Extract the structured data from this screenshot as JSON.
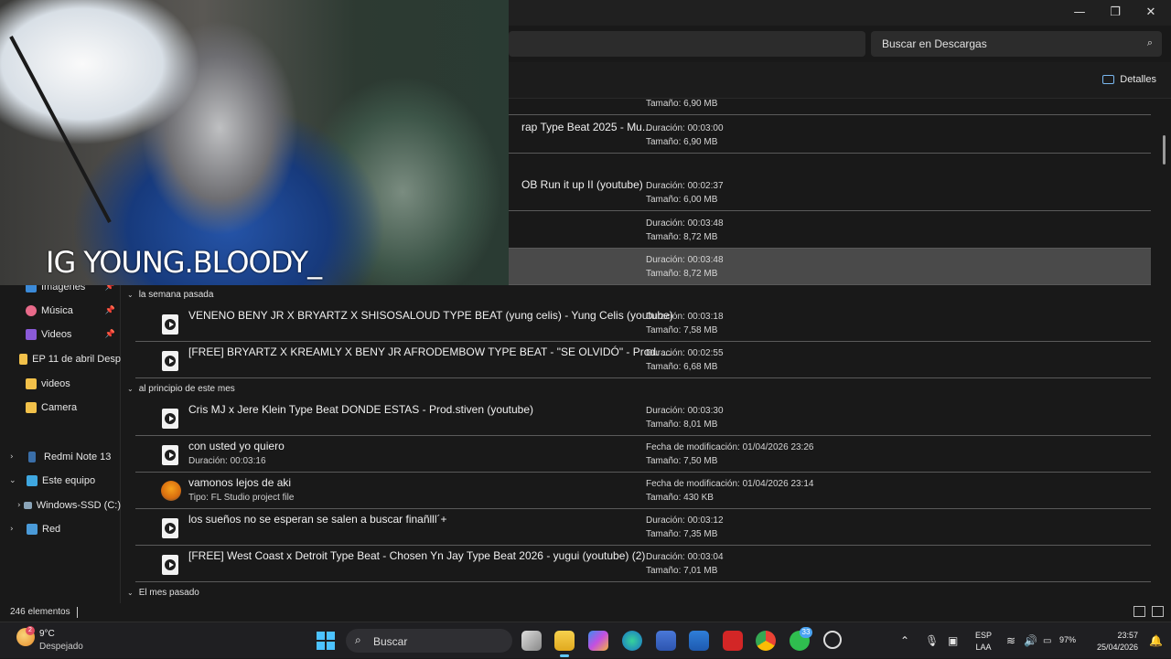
{
  "window": {
    "minimize": "—",
    "maximize": "❐",
    "close": "✕"
  },
  "search": {
    "placeholder": "Buscar en Descargas",
    "icon": "⌕"
  },
  "commandbar": {
    "details_label": "Detalles"
  },
  "webcam": {
    "overlay_text": "IG YOUNG.BLOODY_"
  },
  "sidebar": {
    "items": [
      {
        "label": "Imágenes",
        "icon": "pictures-icon",
        "pinned": true
      },
      {
        "label": "Música",
        "icon": "music-icon",
        "pinned": true
      },
      {
        "label": "Videos",
        "icon": "videos-icon",
        "pinned": true
      },
      {
        "label": "EP 11 de abril Desp",
        "icon": "folder-icon",
        "pinned": false
      },
      {
        "label": "videos",
        "icon": "folder-icon",
        "pinned": false
      },
      {
        "label": "Camera",
        "icon": "folder-icon",
        "pinned": false
      },
      {
        "label": "Redmi Note 13",
        "icon": "phone-icon",
        "pinned": false
      },
      {
        "label": "Este equipo",
        "icon": "pc-icon",
        "pinned": false
      },
      {
        "label": "Windows-SSD (C:)",
        "icon": "drive-icon",
        "pinned": false
      },
      {
        "label": "Red",
        "icon": "network-icon",
        "pinned": false
      }
    ],
    "pin_glyph": "📌"
  },
  "files": {
    "partial_top": {
      "m2": "Tamaño: 6,90 MB"
    },
    "rows_top": [
      {
        "name": "rap Type Beat 2025 - Mu...",
        "m1": "Duración: 00:03:00",
        "m2": "Tamaño: 6,90 MB"
      },
      {
        "name": "OB Run it up II (youtube)",
        "m1": "Duración: 00:02:37",
        "m2": "Tamaño: 6,00 MB"
      },
      {
        "name": "",
        "m1": "Duración: 00:03:48",
        "m2": "Tamaño: 8,72 MB"
      },
      {
        "name": "",
        "m1": "Duración: 00:03:48",
        "m2": "Tamaño: 8,72 MB",
        "selected": true
      }
    ],
    "groups": [
      {
        "label": "la semana pasada",
        "rows": [
          {
            "name": "VENENO BENY JR X BRYARTZ X SHISOSALOUD TYPE BEAT (yung celis) - Yung Celis (youtube)",
            "m1": "Duración: 00:03:18",
            "m2": "Tamaño: 7,58 MB"
          },
          {
            "name": "[FREE]  BRYARTZ X KREAMLY X BENY JR AFRODEMBOW TYPE BEAT - \"SE OLVIDÓ\" - Prod. ...",
            "m1": "Duración: 00:02:55",
            "m2": "Tamaño: 6,68 MB"
          }
        ]
      },
      {
        "label": "al principio de este mes",
        "rows": [
          {
            "name": "Cris MJ x Jere Klein Type Beat DONDE ESTAS - Prod.stiven (youtube)",
            "m1": "Duración: 00:03:30",
            "m2": "Tamaño: 8,01 MB"
          },
          {
            "name": "con usted yo quiero",
            "sub": "Duración: 00:03:16",
            "m1": "Fecha de modificación: 01/04/2026 23:26",
            "m2": "Tamaño: 7,50 MB"
          },
          {
            "name": "vamonos lejos de aki",
            "sub": "Tipo: FL Studio project file",
            "m1": "Fecha de modificación: 01/04/2026 23:14",
            "m2": "Tamaño: 430 KB",
            "fl": true
          },
          {
            "name": "los sueños no se esperan se salen a buscar finañlll´+",
            "m1": "Duración: 00:03:12",
            "m2": "Tamaño: 7,35 MB"
          },
          {
            "name": "[FREE] West Coast x Detroit Type Beat - Chosen  Yn Jay Type Beat 2026 - yugui (youtube) (2)",
            "m1": "Duración: 00:03:04",
            "m2": "Tamaño: 7,01 MB"
          }
        ]
      },
      {
        "label": "El mes pasado",
        "rows": []
      }
    ]
  },
  "status": {
    "count": "246 elementos"
  },
  "taskbar": {
    "weather_temp": "9°C",
    "weather_desc": "Despejado",
    "weather_badge": "2",
    "search_label": "Buscar",
    "whatsapp_badge": "33",
    "lang_line1": "ESP",
    "lang_line2": "LAA",
    "battery": "97%",
    "time": "23:57",
    "date": "25/04/2026",
    "accent": "#60c8ff"
  }
}
